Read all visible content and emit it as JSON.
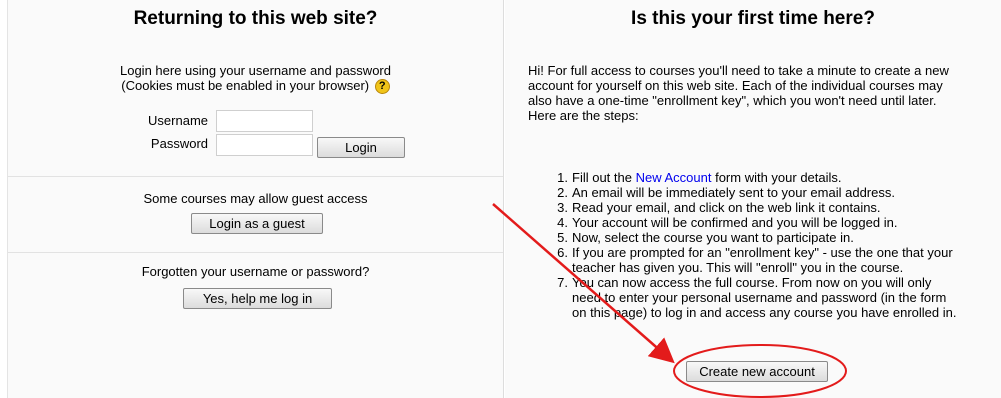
{
  "returning": {
    "heading": "Returning to this web site?",
    "intro_line1": "Login here using your username and password",
    "intro_line2": "(Cookies must be enabled in your browser)",
    "help_icon": "question-mark-help-icon",
    "username_label": "Username",
    "username_value": "",
    "password_label": "Password",
    "password_value": "",
    "login_button": "Login",
    "guest_text": "Some courses may allow guest access",
    "guest_button": "Login as a guest",
    "forgot_text": "Forgotten your username or password?",
    "forgot_button": "Yes, help me log in"
  },
  "first_time": {
    "heading": "Is this your first time here?",
    "intro": "Hi! For full access to courses you'll need to take a minute to create a new account for yourself on this web site. Each of the individual courses may also have a one-time \"enrollment key\", which you won't need until later. Here are the steps:",
    "step1_prefix": "Fill out the ",
    "step1_link": "New Account",
    "step1_suffix": " form with your details.",
    "steps": [
      {
        "num": "2.",
        "text": "An email will be immediately sent to your email address."
      },
      {
        "num": "3.",
        "text": "Read your email, and click on the web link it contains."
      },
      {
        "num": "4.",
        "text": "Your account will be confirmed and you will be logged in."
      },
      {
        "num": "5.",
        "text": "Now, select the course you want to participate in."
      },
      {
        "num": "6.",
        "text": "If you are prompted for an \"enrollment key\" - use the one that your teacher has given you. This will \"enroll\" you in the course."
      },
      {
        "num": "7.",
        "text": "You can now access the full course. From now on you will only need to enter your personal username and password (in the form on this page) to log in and access any course you have enrolled in."
      }
    ],
    "create_button": "Create new account"
  },
  "annotation": {
    "arrow_color": "#e31b1b",
    "circle_color": "#e31b1b"
  }
}
